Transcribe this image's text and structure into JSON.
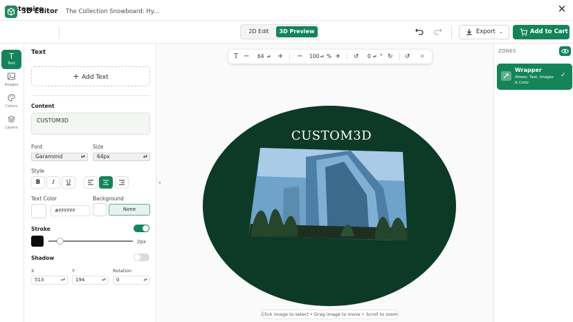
{
  "window": {
    "title": "Customize",
    "close_icon": "close-icon"
  },
  "toolbar": {
    "app_title": "3D Editor",
    "document_title": "The Collection Snowboard: Hy...",
    "modes": [
      "2D Edit",
      "3D Preview"
    ],
    "active_mode": "3D Preview",
    "export_label": "Export",
    "add_to_cart_label": "Add to Cart"
  },
  "rail": {
    "items": [
      {
        "label": "Text",
        "icon": "text-icon",
        "active": true
      },
      {
        "label": "Images",
        "icon": "image-icon",
        "active": false
      },
      {
        "label": "Colors",
        "icon": "palette-icon",
        "active": false
      },
      {
        "label": "Layers",
        "icon": "layers-icon",
        "active": false
      }
    ]
  },
  "panel": {
    "title": "Text",
    "add_text_label": "Add Text",
    "content_label": "Content",
    "content_value": "CUSTOM3D",
    "font_label": "Font",
    "font_value": "Garamond",
    "size_label": "Size",
    "size_value": "64px",
    "style_label": "Style",
    "text_color_label": "Text Color",
    "text_color_value": "#FFFFFF",
    "background_label": "Background",
    "background_value": "None",
    "stroke_label": "Stroke",
    "stroke_enabled": true,
    "stroke_color": "#0b0b0b",
    "stroke_width_label": "2px",
    "stroke_width_value": 2,
    "shadow_label": "Shadow",
    "shadow_enabled": false,
    "x_label": "X",
    "x_value": "513",
    "y_label": "Y",
    "y_value": "194",
    "rotation_label": "Rotation",
    "rotation_value": "0"
  },
  "canvas_toolbar": {
    "font_size": "64",
    "zoom": "100",
    "zoom_unit": "%",
    "rotation": "0",
    "rotation_unit": "°"
  },
  "canvas": {
    "preview_text": "CUSTOM3D",
    "board_color": "#0c3a26",
    "hint": "Click image to select • Drag image to move • Scroll to zoom"
  },
  "zones": {
    "header": "ZONES",
    "items": [
      {
        "name": "Wrapper",
        "description": "Allows: Text, Images & Color",
        "selected": true
      }
    ]
  },
  "colors": {
    "accent": "#15845a",
    "board": "#0c3a26"
  }
}
